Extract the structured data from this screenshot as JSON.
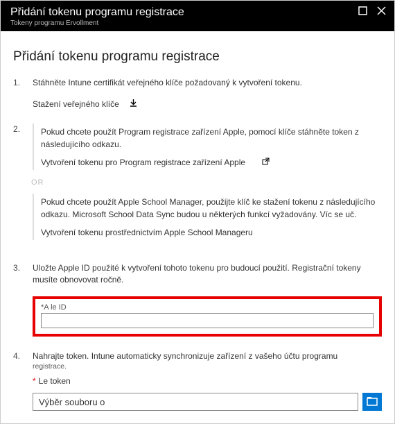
{
  "titlebar": {
    "title": "Přidání tokenu programu registrace",
    "subtitle": "Tokeny programu Ervollment"
  },
  "pageTitle": "Přidání tokenu programu registrace",
  "steps": {
    "s1": {
      "num": "1.",
      "text": "Stáhněte Intune certifikát veřejného klíče požadovaný k vytvoření tokenu.",
      "link": "Stažení veřejného klíče"
    },
    "s2": {
      "num": "2.",
      "optA": {
        "text": "Pokud chcete použít Program registrace zařízení Apple, pomocí klíče stáhněte token z následujícího odkazu.",
        "link": "Vytvoření tokenu pro Program registrace zařízení Apple"
      },
      "or": "OR",
      "optB": {
        "text": "Pokud chcete použít Apple School Manager, použijte klíč ke stažení tokenu z následujícího odkazu. Microsoft School Data Sync budou u některých funkcí vyžadovány. Víc se uč.",
        "link": "Vytvoření tokenu prostřednictvím Apple School Manageru"
      }
    },
    "s3": {
      "num": "3.",
      "text": "Uložte Apple ID použité k vytvoření tohoto tokenu pro budoucí použití. Registrační tokeny musíte obnovovat ročně.",
      "fieldLabel": "*A le ID"
    },
    "s4": {
      "num": "4.",
      "text": "Nahrajte token. Intune automaticky synchronizuje zařízení z vašeho účtu programu",
      "sub": "registrace.",
      "tokenLabel": "Le token",
      "tokenValue": "Výběr souboru o"
    }
  }
}
